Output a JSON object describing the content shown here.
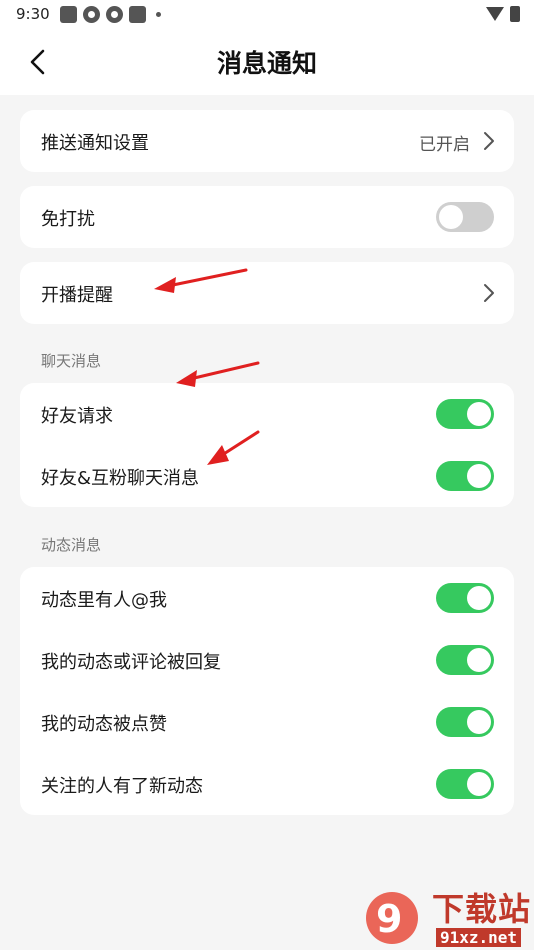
{
  "status_bar": {
    "time": "9:30"
  },
  "header": {
    "title": "消息通知"
  },
  "cards": {
    "push": {
      "label": "推送通知设置",
      "value": "已开启"
    },
    "dnd": {
      "label": "免打扰",
      "on": false
    },
    "live": {
      "label": "开播提醒"
    }
  },
  "chat_section": {
    "title": "聊天消息",
    "items": [
      {
        "label": "好友请求",
        "on": true
      },
      {
        "label": "好友&互粉聊天消息",
        "on": true
      }
    ]
  },
  "activity_section": {
    "title": "动态消息",
    "items": [
      {
        "label": "动态里有人@我",
        "on": true
      },
      {
        "label": "我的动态或评论被回复",
        "on": true
      },
      {
        "label": "我的动态被点赞",
        "on": true
      },
      {
        "label": "关注的人有了新动态",
        "on": true
      }
    ]
  },
  "watermark": {
    "brand": "下载站",
    "site": "91xz.net"
  },
  "colors": {
    "toggle_on": "#36c95f",
    "toggle_off": "#cfcfcf",
    "annotation_arrow": "#e02020"
  }
}
